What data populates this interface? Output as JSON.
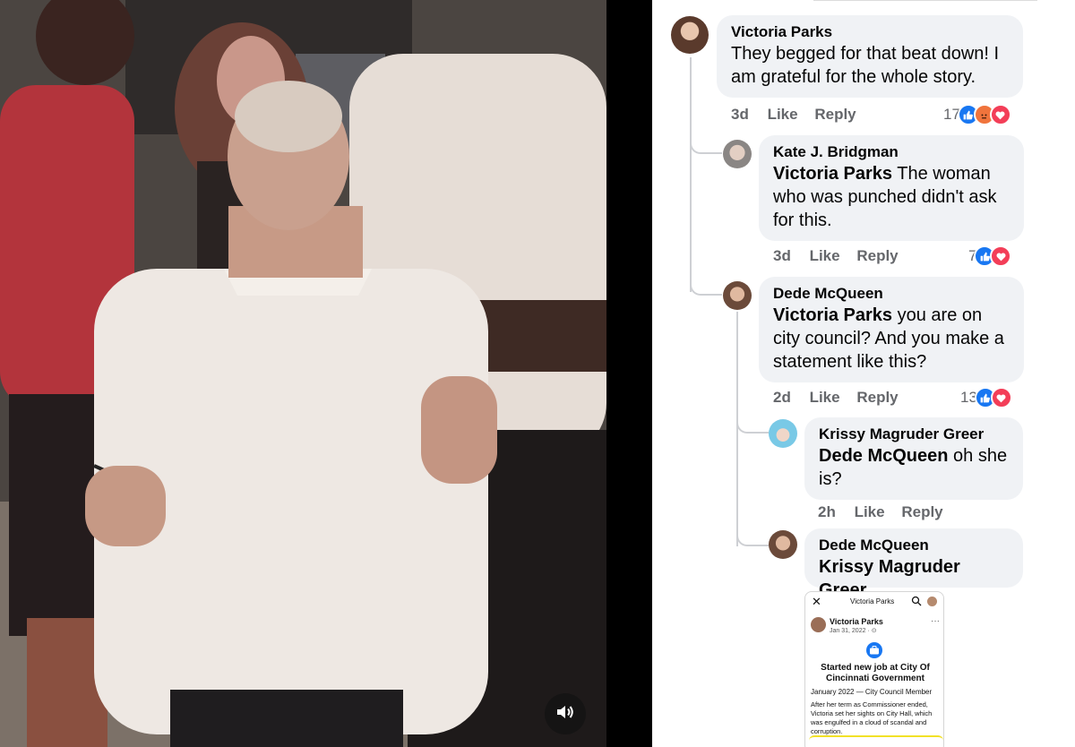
{
  "video": {
    "volume_icon": "speaker-volume-icon"
  },
  "comments": [
    {
      "author": "Victoria Parks",
      "mention": "",
      "text": "They begged for that beat down! I am grateful for the whole story.",
      "time": "3d",
      "like_label": "Like",
      "reply_label": "Reply",
      "reaction_count": "17",
      "reactions": [
        "like-icon",
        "angry-icon",
        "love-icon"
      ]
    },
    {
      "author": "Kate J. Bridgman",
      "mention": "Victoria Parks",
      "text": " The woman who was punched didn't ask for this.",
      "time": "3d",
      "like_label": "Like",
      "reply_label": "Reply",
      "reaction_count": "7",
      "reactions": [
        "like-icon",
        "love-icon"
      ]
    },
    {
      "author": "Dede McQueen",
      "mention": "Victoria Parks",
      "text": " you are on city council? And you make a statement like this?",
      "time": "2d",
      "like_label": "Like",
      "reply_label": "Reply",
      "reaction_count": "13",
      "reactions": [
        "like-icon",
        "love-icon"
      ]
    },
    {
      "author": "Krissy Magruder Greer",
      "mention": "Dede McQueen",
      "text": " oh she is?",
      "time": "2h",
      "like_label": "Like",
      "reply_label": "Reply"
    },
    {
      "author": "Dede McQueen",
      "mention": "Krissy Magruder Greer",
      "text": ""
    }
  ],
  "embedded_screenshot": {
    "close": "✕",
    "title": "Victoria Parks",
    "author": "Victoria Parks",
    "date": "Jan 31, 2022 · ⊙",
    "more": "···",
    "headline": "Started new job at City Of Cincinnati Government",
    "subline": "January 2022 — City Council Member",
    "body": "After her term as Commissioner ended, Victoria set her sights on City Hall, which was engulfed in a cloud of scandal and corruption.",
    "highlight_color": "#f2e128"
  },
  "colors": {
    "bubble": "#f0f2f5",
    "meta_text": "#65676b",
    "like": "#1877f2",
    "love": "#f33e58",
    "angry": "#f0743c"
  }
}
